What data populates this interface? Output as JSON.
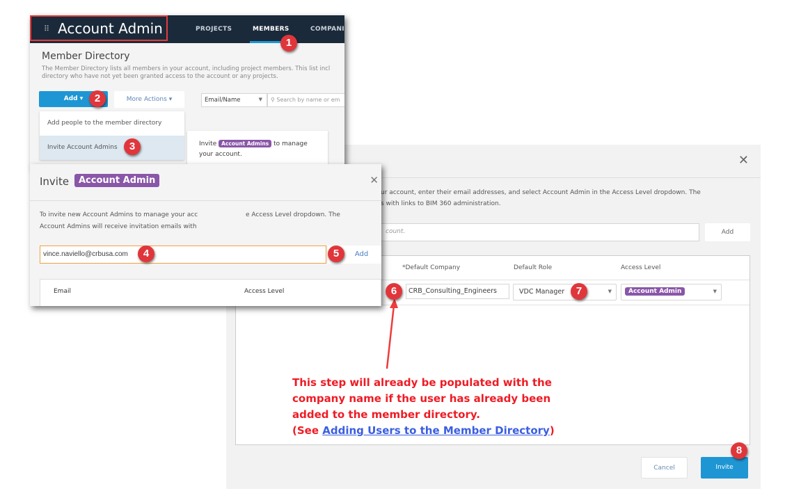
{
  "app": {
    "title": "Account Admin",
    "nav": [
      "PROJECTS",
      "MEMBERS",
      "COMPANIES"
    ],
    "active_nav": "MEMBERS"
  },
  "directory": {
    "title": "Member Directory",
    "description_1": "The Member Directory lists all members in your account, including project members. This list incl",
    "description_2": "directory who have not yet been granted access to the account or any projects.",
    "add_label": "Add",
    "more_actions_label": "More Actions",
    "filter_value": "Email/Name",
    "search_placeholder": "Search by name or em",
    "menu": [
      "Add people to the member directory",
      "Invite Account Admins"
    ],
    "tooltip": {
      "pre": "Invite",
      "badge": "Account Admins",
      "post": "to manage",
      "line2": "your account."
    }
  },
  "invite_small": {
    "title": "Invite",
    "badge": "Account Admin",
    "text_1": "To invite new Account Admins to manage your acc",
    "text_1b": "e Access Level dropdown. The",
    "text_2": "Account Admins will receive invitation emails with",
    "email_value": "vince.naviello@crbusa.com",
    "add_label": "Add",
    "col_email": "Email",
    "col_access": "Access Level"
  },
  "invite_dialog": {
    "text_1": "ur account, enter their email addresses, and select Account Admin in the Access Level dropdown. The",
    "text_2": "s with links to BIM 360 administration.",
    "input_placeholder": "count.",
    "add_label": "Add",
    "columns": [
      "*Default Company",
      "Default Role",
      "Access Level"
    ],
    "row": {
      "company": "CRB_Consulting_Engineers",
      "role": "VDC Manager",
      "access": "Account Admin"
    },
    "cancel_label": "Cancel",
    "invite_label": "Invite"
  },
  "annotation": {
    "line1": "This step will already be populated with the",
    "line2": "company name if the user has already been",
    "line3": "added to the member directory.",
    "see_pre": "(See ",
    "link": "Adding Users to the Member Directory",
    "see_post": ")"
  },
  "steps": [
    "1",
    "2",
    "3",
    "4",
    "5",
    "6",
    "7",
    "8"
  ],
  "colors": {
    "header": "#1b2a3a",
    "primary": "#1e96d4",
    "purple": "#8a56a8",
    "step": "#e0363b",
    "note": "#ee1c25",
    "link": "#3b5ee0"
  }
}
